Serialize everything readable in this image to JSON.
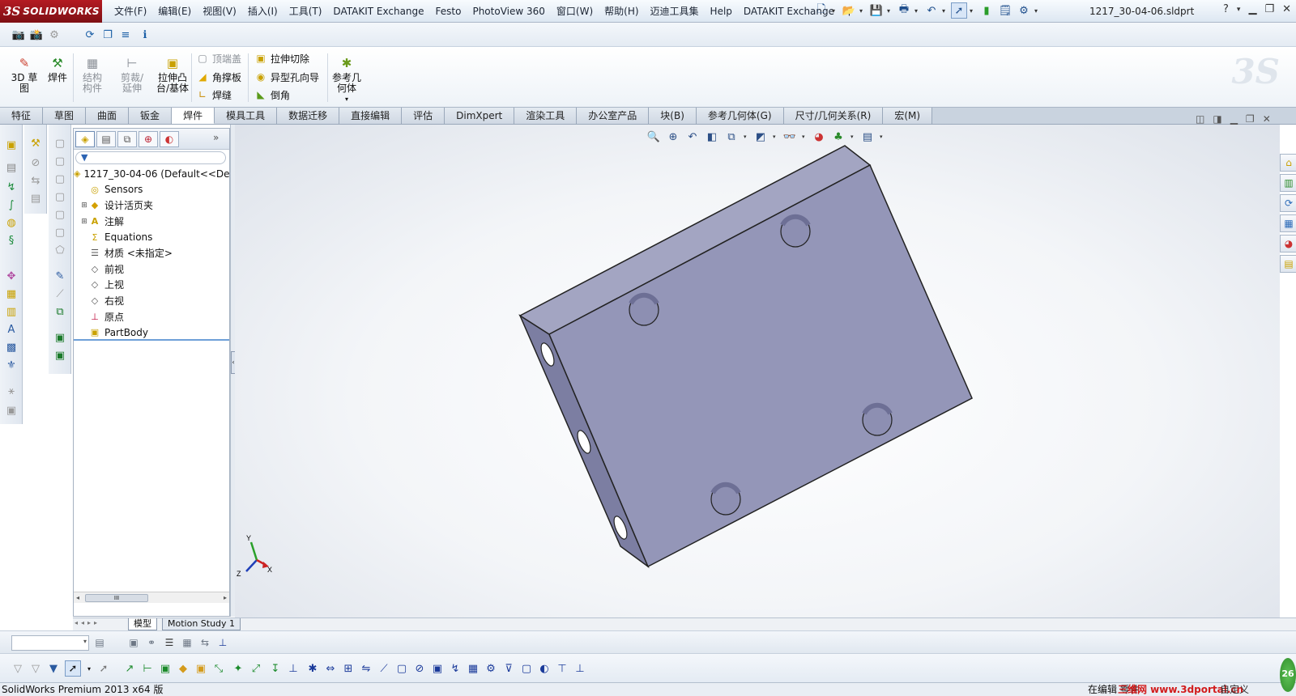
{
  "app": {
    "logo_mark": "3S",
    "logo_text": "SOLIDWORKS",
    "document_title": "1217_30-04-06.sldprt"
  },
  "menu": [
    "文件(F)",
    "编辑(E)",
    "视图(V)",
    "插入(I)",
    "工具(T)",
    "DATAKIT Exchange",
    "Festo",
    "PhotoView 360",
    "窗口(W)",
    "帮助(H)",
    "迈迪工具集",
    "Help",
    "DATAKIT Exchange"
  ],
  "ribbon": {
    "btn_3d_sketch": "3D 草图",
    "btn_weldment": "焊件",
    "btn_structural_member": "结构构件",
    "btn_trim_extend": "剪裁/延伸",
    "btn_extruded_boss": "拉伸凸台/基体",
    "btn_end_cap": "顶端盖",
    "btn_gusset": "角撑板",
    "btn_weld_bead": "焊缝",
    "btn_extruded_cut": "拉伸切除",
    "btn_hole_wizard": "异型孔向导",
    "btn_chamfer": "倒角",
    "btn_reference_geometry": "参考几何体"
  },
  "tabs": [
    "特征",
    "草图",
    "曲面",
    "钣金",
    "焊件",
    "模具工具",
    "数据迁移",
    "直接编辑",
    "评估",
    "DimXpert",
    "渲染工具",
    "办公室产品",
    "块(B)",
    "参考几何体(G)",
    "尺寸/几何关系(R)",
    "宏(M)"
  ],
  "active_tab_index": 4,
  "feature_tree": {
    "root": "1217_30-04-06  (Default<<De",
    "items": [
      {
        "label": "Sensors",
        "icon": "sensor-icon",
        "expandable": false
      },
      {
        "label": "设计活页夹",
        "icon": "design-binder-icon",
        "expandable": true
      },
      {
        "label": "注解",
        "icon": "annotations-icon",
        "expandable": true
      },
      {
        "label": "Equations",
        "icon": "equations-icon",
        "expandable": false
      },
      {
        "label": "材质 <未指定>",
        "icon": "material-icon",
        "expandable": false
      },
      {
        "label": "前视",
        "icon": "plane-icon",
        "expandable": false
      },
      {
        "label": "上视",
        "icon": "plane-icon",
        "expandable": false
      },
      {
        "label": "右视",
        "icon": "plane-icon",
        "expandable": false
      },
      {
        "label": "原点",
        "icon": "origin-icon",
        "expandable": false
      },
      {
        "label": "PartBody",
        "icon": "body-icon",
        "expandable": false
      }
    ]
  },
  "model_tabs": [
    "模型",
    "Motion Study 1"
  ],
  "axes": {
    "x": "X",
    "y": "Y",
    "z": "Z"
  },
  "status": {
    "left": "SolidWorks Premium 2013 x64 版",
    "right": "在编辑 零件",
    "right_tail": "自定义",
    "watermark": "三维网 www.3dportal.cn",
    "badge": "26"
  },
  "colors": {
    "part_top": "#9597b8",
    "part_side": "#7f81a4",
    "part_front": "#6f7196",
    "logo_red": "#a8161c"
  }
}
